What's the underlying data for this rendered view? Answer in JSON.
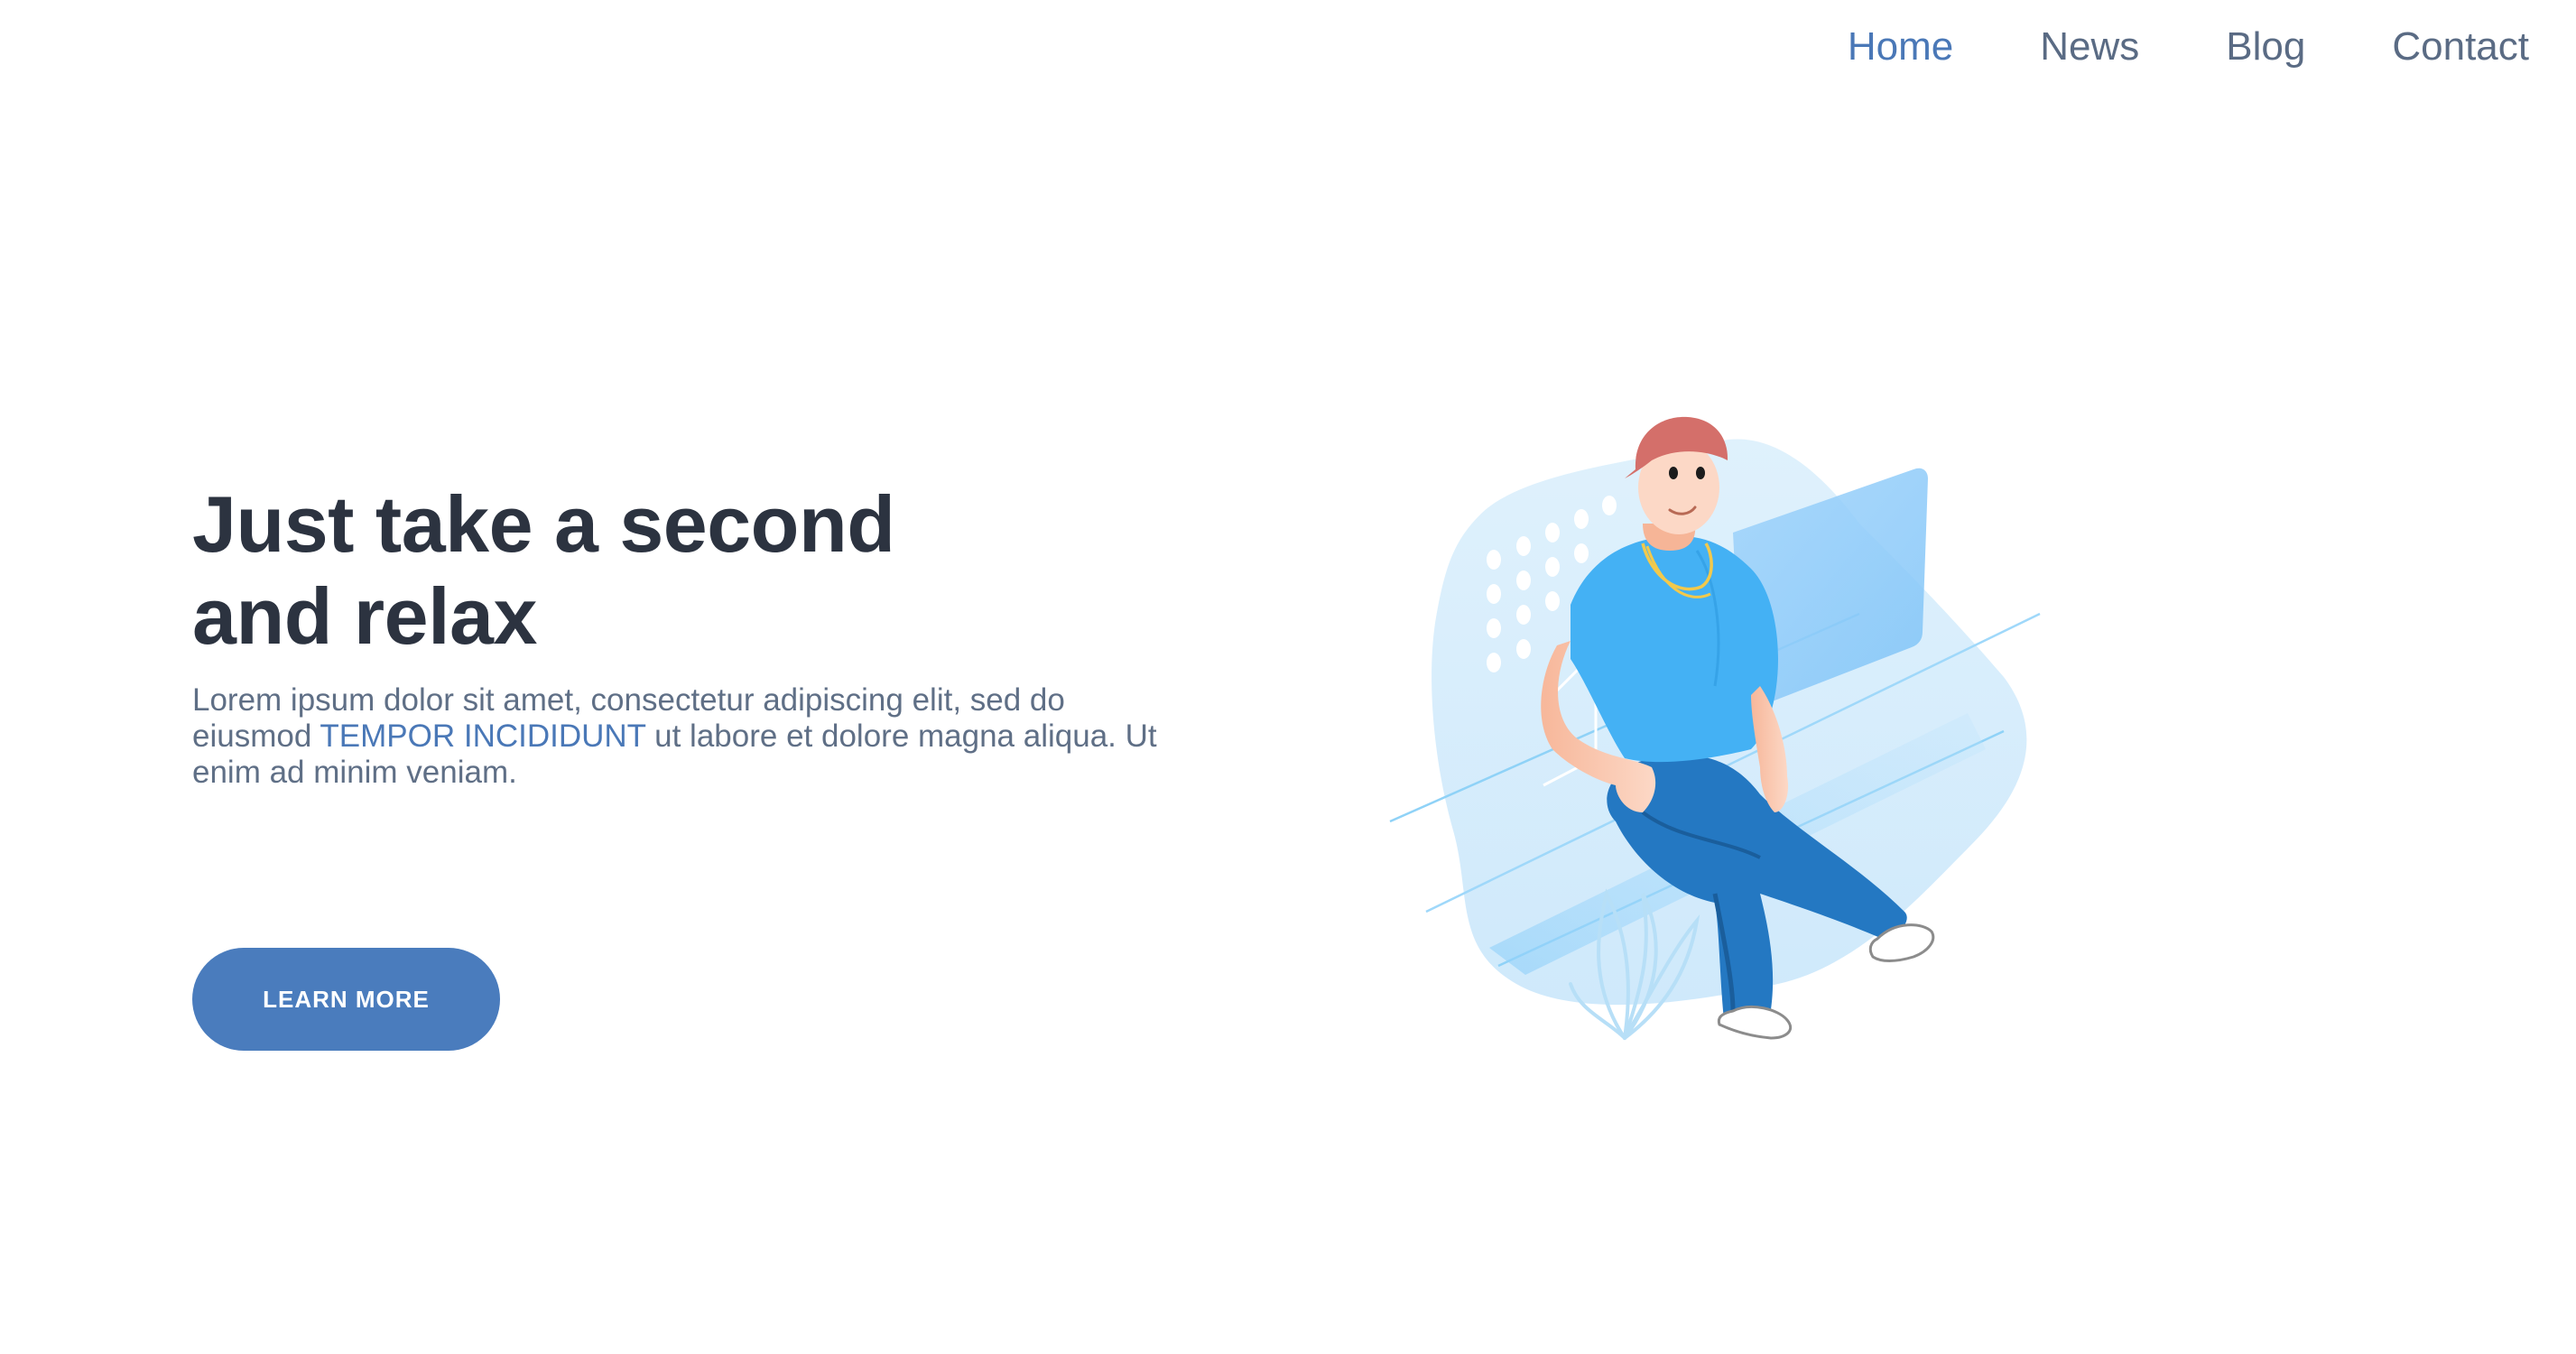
{
  "nav": {
    "items": [
      {
        "label": "Home",
        "active": true
      },
      {
        "label": "News",
        "active": false
      },
      {
        "label": "Blog",
        "active": false
      },
      {
        "label": "Contact",
        "active": false
      }
    ]
  },
  "hero": {
    "title_line1": "Just take a second",
    "title_line2": "and relax",
    "lead_before": "Lorem ipsum dolor sit amet, consectetur adipiscing elit, sed do eiusmod ",
    "lead_highlight": "TEMPOR INCIDIDUNT",
    "lead_after": " ut labore et dolore magna aliqua. Ut enim ad minim veniam.",
    "cta_label": "LEARN MORE"
  },
  "colors": {
    "accent": "#4a78b7",
    "heading": "#2c3340",
    "body": "#5f6f86",
    "button": "#4a7cbd"
  }
}
